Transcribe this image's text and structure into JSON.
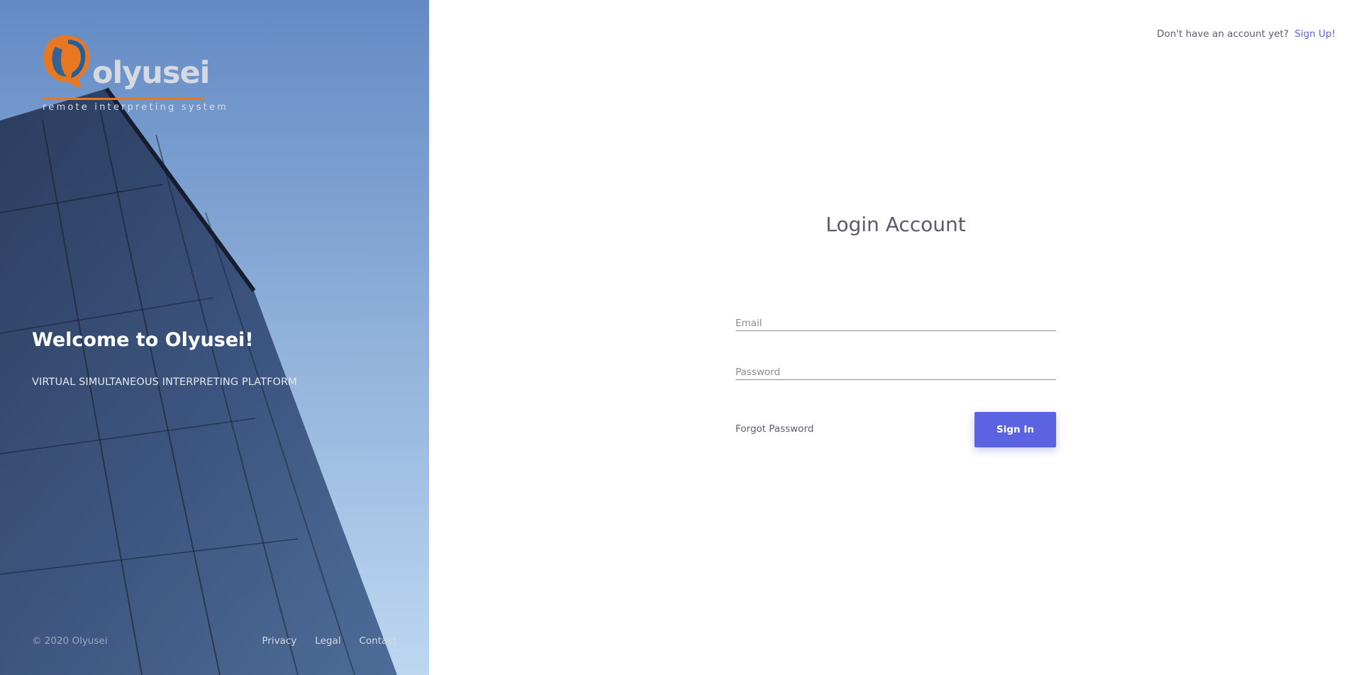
{
  "brand": {
    "name": "olyusei",
    "tagline": "remote interpreting system"
  },
  "aside": {
    "welcome": "Welcome to Olyusei!",
    "subtitle": "VIRTUAL SIMULTANEOUS INTERPRETING PLATFORM",
    "copyright": "© 2020 Olyusei",
    "links": [
      "Privacy",
      "Legal",
      "Contact"
    ]
  },
  "topbar": {
    "prompt": "Don't have an account yet?",
    "signup_label": "Sign Up!"
  },
  "form": {
    "title": "Login Account",
    "email_placeholder": "Email",
    "email_value": "",
    "password_placeholder": "Password",
    "password_value": "",
    "forgot_label": "Forgot Password",
    "submit_label": "Sign In"
  },
  "colors": {
    "accent": "#5b63e0",
    "logo_orange": "#e87722",
    "logo_blue": "#1f5fa0",
    "title_text": "#585c6b"
  }
}
